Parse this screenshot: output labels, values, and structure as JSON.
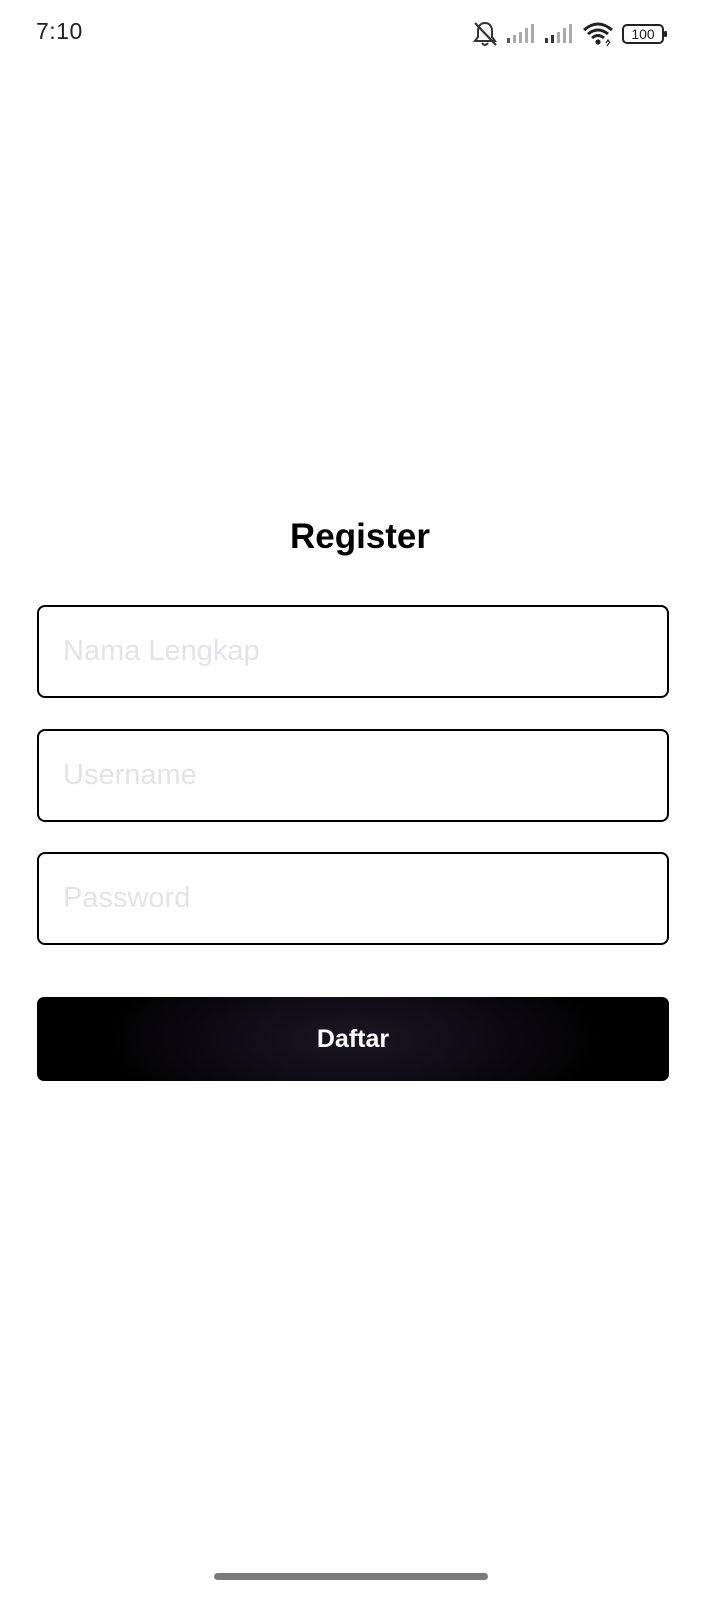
{
  "status_bar": {
    "time": "7:10",
    "battery": "100",
    "icons": [
      "bell-muted-icon",
      "signal-icon",
      "signal-icon",
      "wifi-icon",
      "battery-icon"
    ]
  },
  "form": {
    "title": "Register",
    "fields": [
      {
        "placeholder": "Nama Lengkap",
        "value": ""
      },
      {
        "placeholder": "Username",
        "value": ""
      },
      {
        "placeholder": "Password",
        "value": ""
      }
    ],
    "submit_label": "Daftar"
  },
  "colors": {
    "background": "#ffffff",
    "field_border": "#000000",
    "placeholder": "#e4e3e8",
    "button_bg": "#000000",
    "button_text": "#ffffff"
  }
}
